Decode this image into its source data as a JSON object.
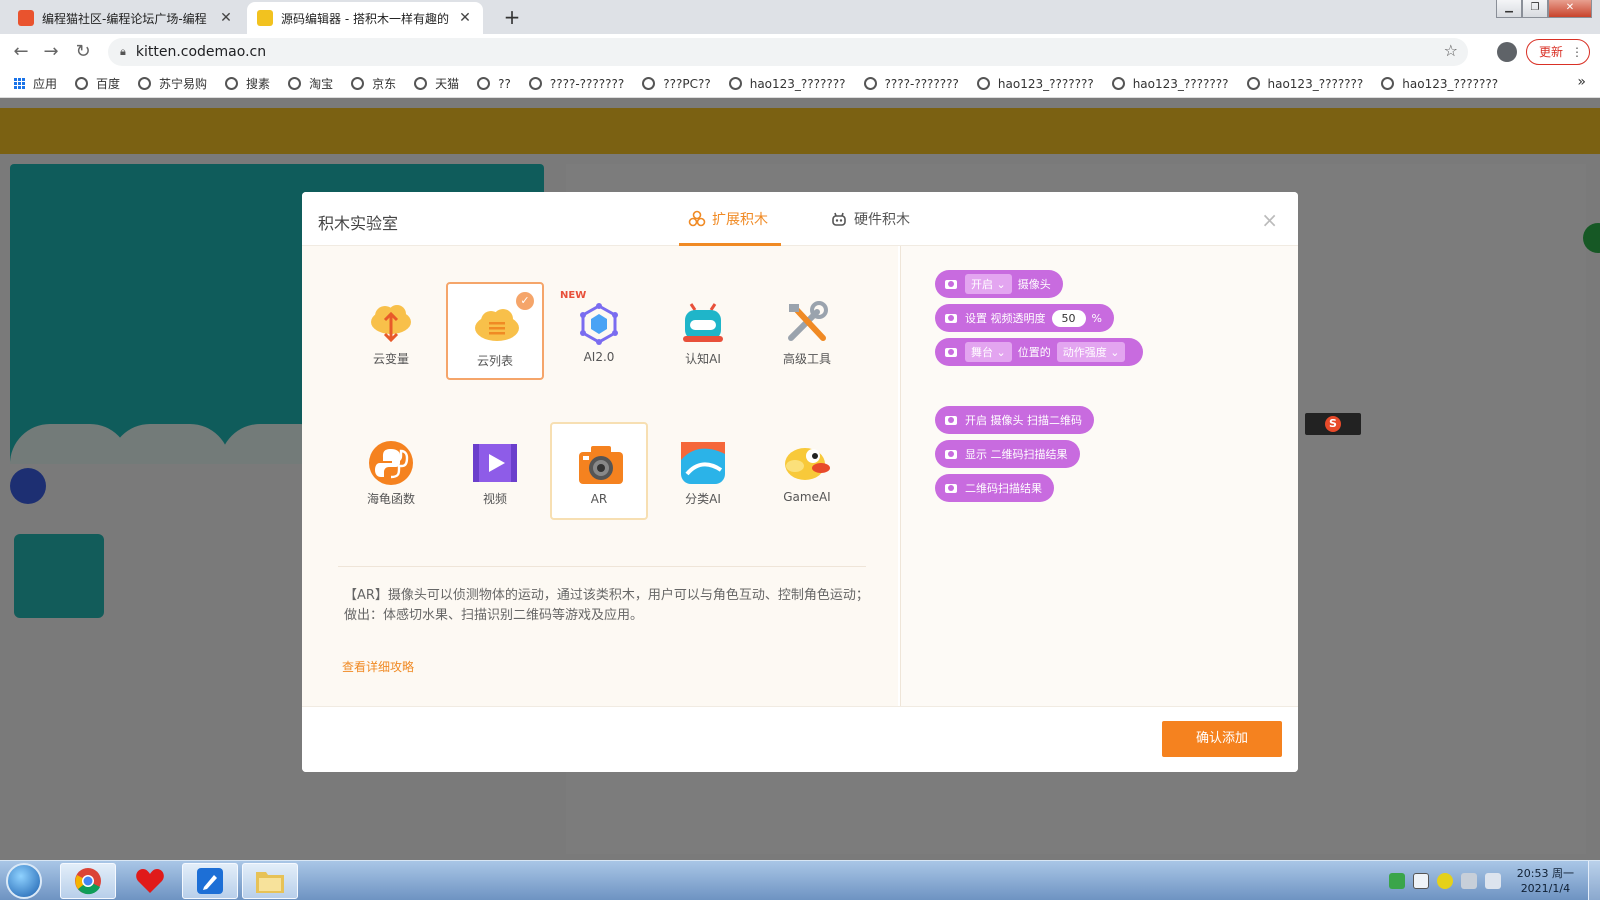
{
  "browser": {
    "tabs": [
      {
        "title": "编程猫社区-编程论坛广场-编程",
        "active": false
      },
      {
        "title": "源码编辑器 - 搭积木一样有趣的",
        "active": true
      }
    ],
    "new_tab": "+",
    "url": "kitten.codemao.cn",
    "update_label": "更新",
    "bookmarks": [
      "应用",
      "百度",
      "苏宁易购",
      "搜素",
      "淘宝",
      "京东",
      "天猫",
      "??",
      "????-???????",
      "???PC??",
      "hao123_???????",
      "????-???????",
      "hao123_???????",
      "hao123_???????",
      "hao123_???????",
      "hao123_???????"
    ],
    "bookmarks_more": "»"
  },
  "modal": {
    "title": "积木实验室",
    "tabs": [
      {
        "label": "扩展积木",
        "active": true
      },
      {
        "label": "硬件积木",
        "active": false
      }
    ],
    "close": "×",
    "extensions": [
      {
        "label": "云变量",
        "icon": "cloud-variable-icon",
        "selected": false
      },
      {
        "label": "云列表",
        "icon": "cloud-list-icon",
        "selected": true
      },
      {
        "label": "AI2.0",
        "icon": "ai2-icon",
        "badge": "NEW"
      },
      {
        "label": "认知AI",
        "icon": "robot-icon"
      },
      {
        "label": "高级工具",
        "icon": "tools-icon"
      },
      {
        "label": "海龟函数",
        "icon": "python-turtle-icon"
      },
      {
        "label": "视频",
        "icon": "video-icon"
      },
      {
        "label": "AR",
        "icon": "camera-icon",
        "active": true
      },
      {
        "label": "分类AI",
        "icon": "classify-ai-icon"
      },
      {
        "label": "GameAI",
        "icon": "flappy-bird-icon"
      }
    ],
    "description": "【AR】摄像头可以侦测物体的运动，通过该类积木，用户可以与角色互动、控制角色运动；做出：体感切水果、扫描识别二维码等游戏及应用。",
    "detail_link": "查看详细攻略",
    "blocks": {
      "b1": {
        "dropdown": "开启",
        "text": "摄像头"
      },
      "b2": {
        "text": "设置 视频透明度",
        "value": "50",
        "unit": "%"
      },
      "b3": {
        "dropdown1": "舞台",
        "text": "位置的",
        "dropdown2": "动作强度"
      },
      "b4": {
        "text": "开启 摄像头 扫描二维码"
      },
      "b5": {
        "text": "显示 二维码扫描结果"
      },
      "b6": {
        "text": "二维码扫描结果"
      }
    },
    "confirm_label": "确认添加"
  },
  "taskbar": {
    "clock_time": "20:53 周一",
    "clock_date": "2021/1/4"
  },
  "colors": {
    "accent": "#f5821f",
    "block_purple": "#c86bdf",
    "selected_border": "#f5a56a"
  }
}
